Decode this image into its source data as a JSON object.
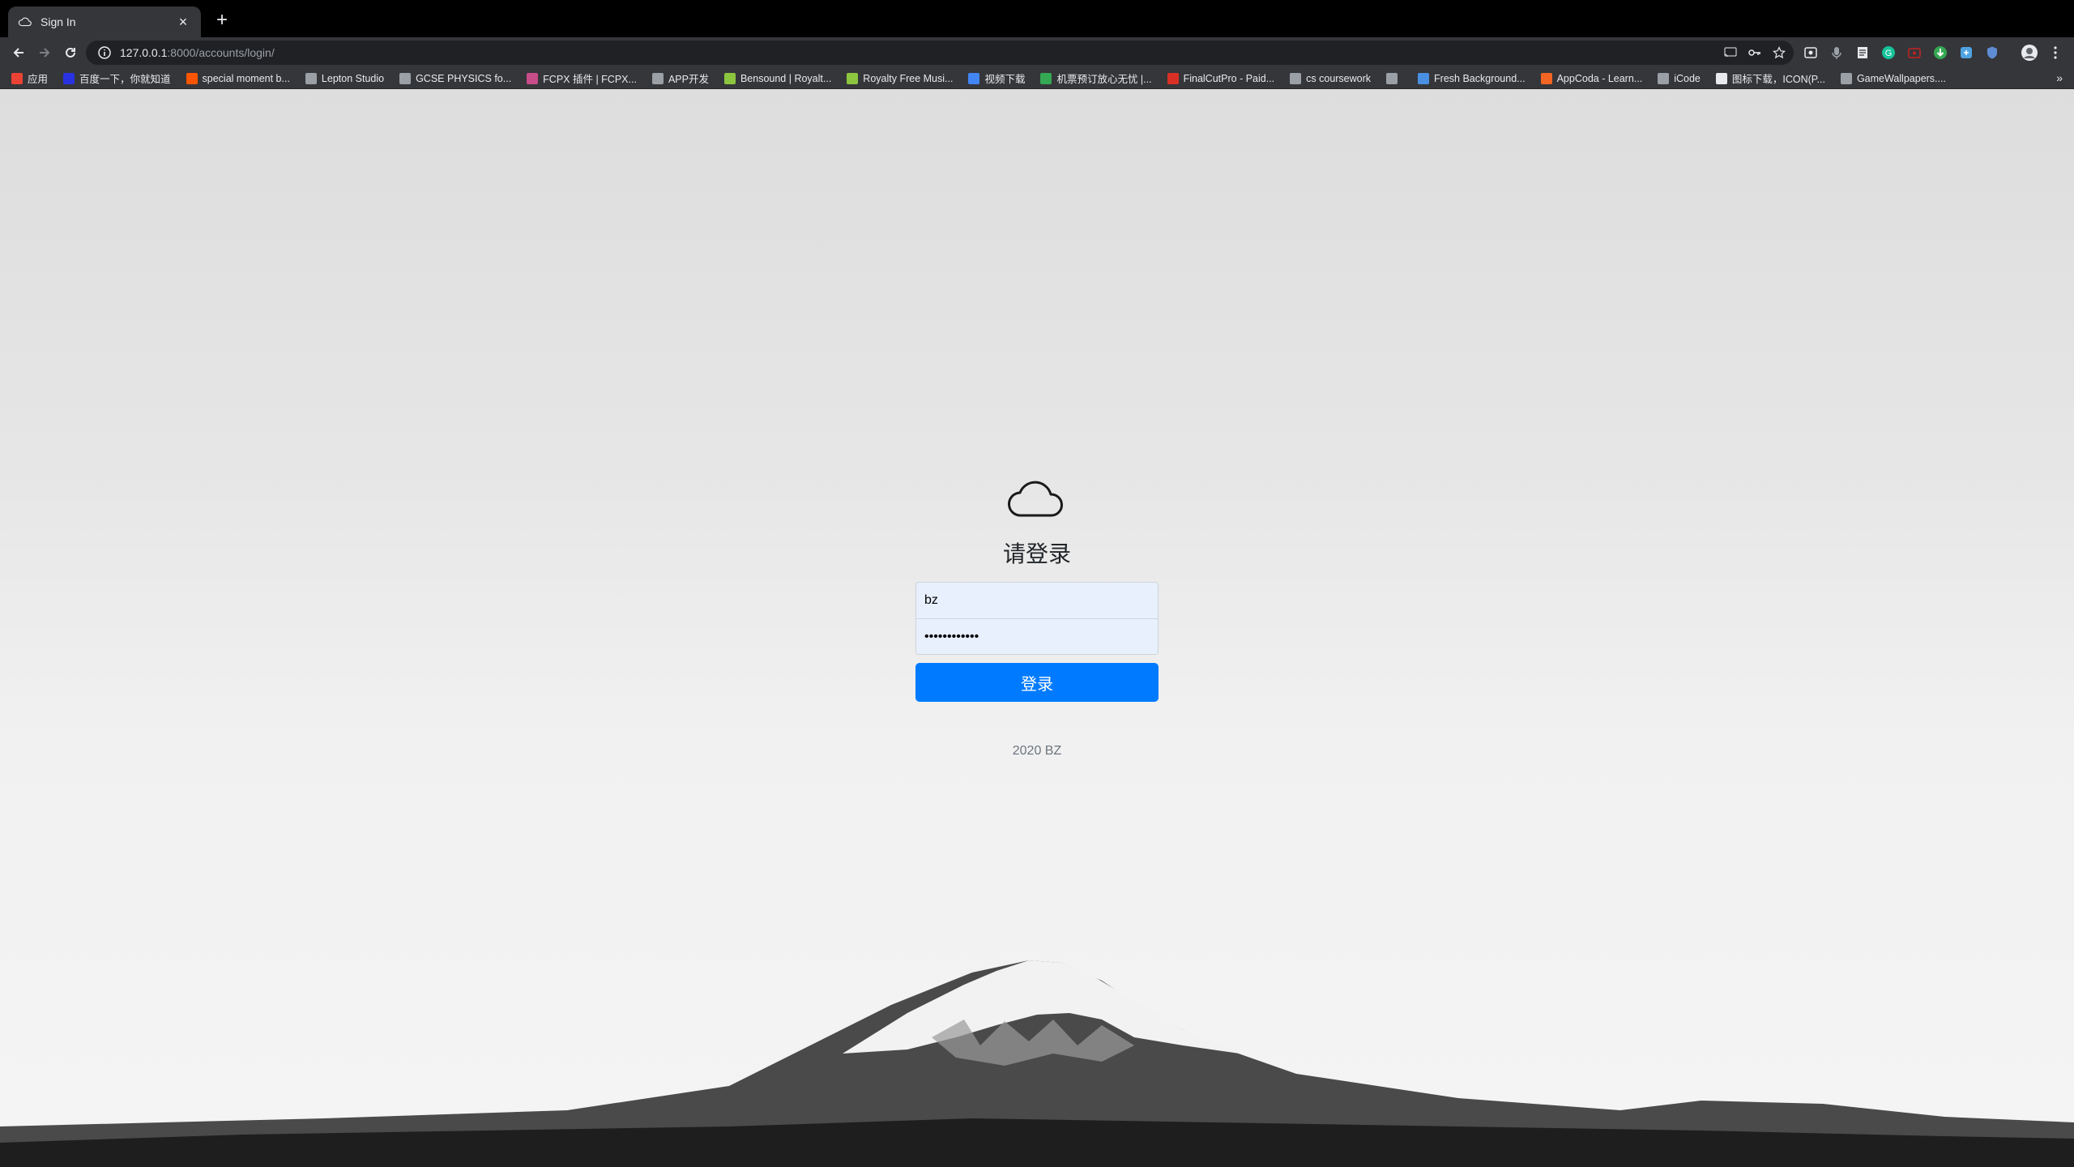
{
  "browser": {
    "tab_title": "Sign In",
    "tab_close": "×",
    "new_tab": "+",
    "url_host": "127.0.0.1",
    "url_rest": ":8000/accounts/login/",
    "bookmarks_more": "»"
  },
  "bookmarks": [
    {
      "label": "应用",
      "icon": "apps-grid-icon",
      "color": "#ea4335"
    },
    {
      "label": "百度一下，你就知道",
      "icon": "baidu-icon",
      "color": "#2932e1"
    },
    {
      "label": "special moment b...",
      "icon": "soundcloud-icon",
      "color": "#ff5500"
    },
    {
      "label": "Lepton Studio",
      "icon": "globe-icon",
      "color": "#9aa0a6"
    },
    {
      "label": "GCSE PHYSICS fo...",
      "icon": "globe-icon",
      "color": "#9aa0a6"
    },
    {
      "label": "FCPX 插件 | FCPX...",
      "icon": "fcpx-icon",
      "color": "#c84b8a"
    },
    {
      "label": "APP开发",
      "icon": "folder-icon",
      "color": "#9aa0a6"
    },
    {
      "label": "Bensound | Royalt...",
      "icon": "bensound-icon",
      "color": "#8cc63f"
    },
    {
      "label": "Royalty Free Musi...",
      "icon": "bensound-icon",
      "color": "#8cc63f"
    },
    {
      "label": "视频下载",
      "icon": "video-download-icon",
      "color": "#4285f4"
    },
    {
      "label": "机票预订放心无忧 |...",
      "icon": "flight-icon",
      "color": "#34a853"
    },
    {
      "label": "FinalCutPro - Paid...",
      "icon": "finalcut-icon",
      "color": "#d93025"
    },
    {
      "label": "cs coursework",
      "icon": "folder-icon",
      "color": "#9aa0a6"
    },
    {
      "label": "",
      "icon": "globe-icon",
      "color": "#9aa0a6"
    },
    {
      "label": "Fresh Background...",
      "icon": "fresh-icon",
      "color": "#4a90e2"
    },
    {
      "label": "AppCoda - Learn...",
      "icon": "appcoda-icon",
      "color": "#f26522"
    },
    {
      "label": "iCode",
      "icon": "globe-icon",
      "color": "#9aa0a6"
    },
    {
      "label": "图标下载，ICON(P...",
      "icon": "iconfont-icon",
      "color": "#e8eaed"
    },
    {
      "label": "GameWallpapers....",
      "icon": "gw-icon",
      "color": "#9aa0a6"
    }
  ],
  "login": {
    "heading": "请登录",
    "username_value": "bz",
    "password_value": "••••••••••••",
    "submit_label": "登录",
    "footer": "2020 BZ"
  },
  "colors": {
    "accent": "#007bff",
    "chrome_dark": "#35363a",
    "autofill": "#e8f0fe"
  }
}
